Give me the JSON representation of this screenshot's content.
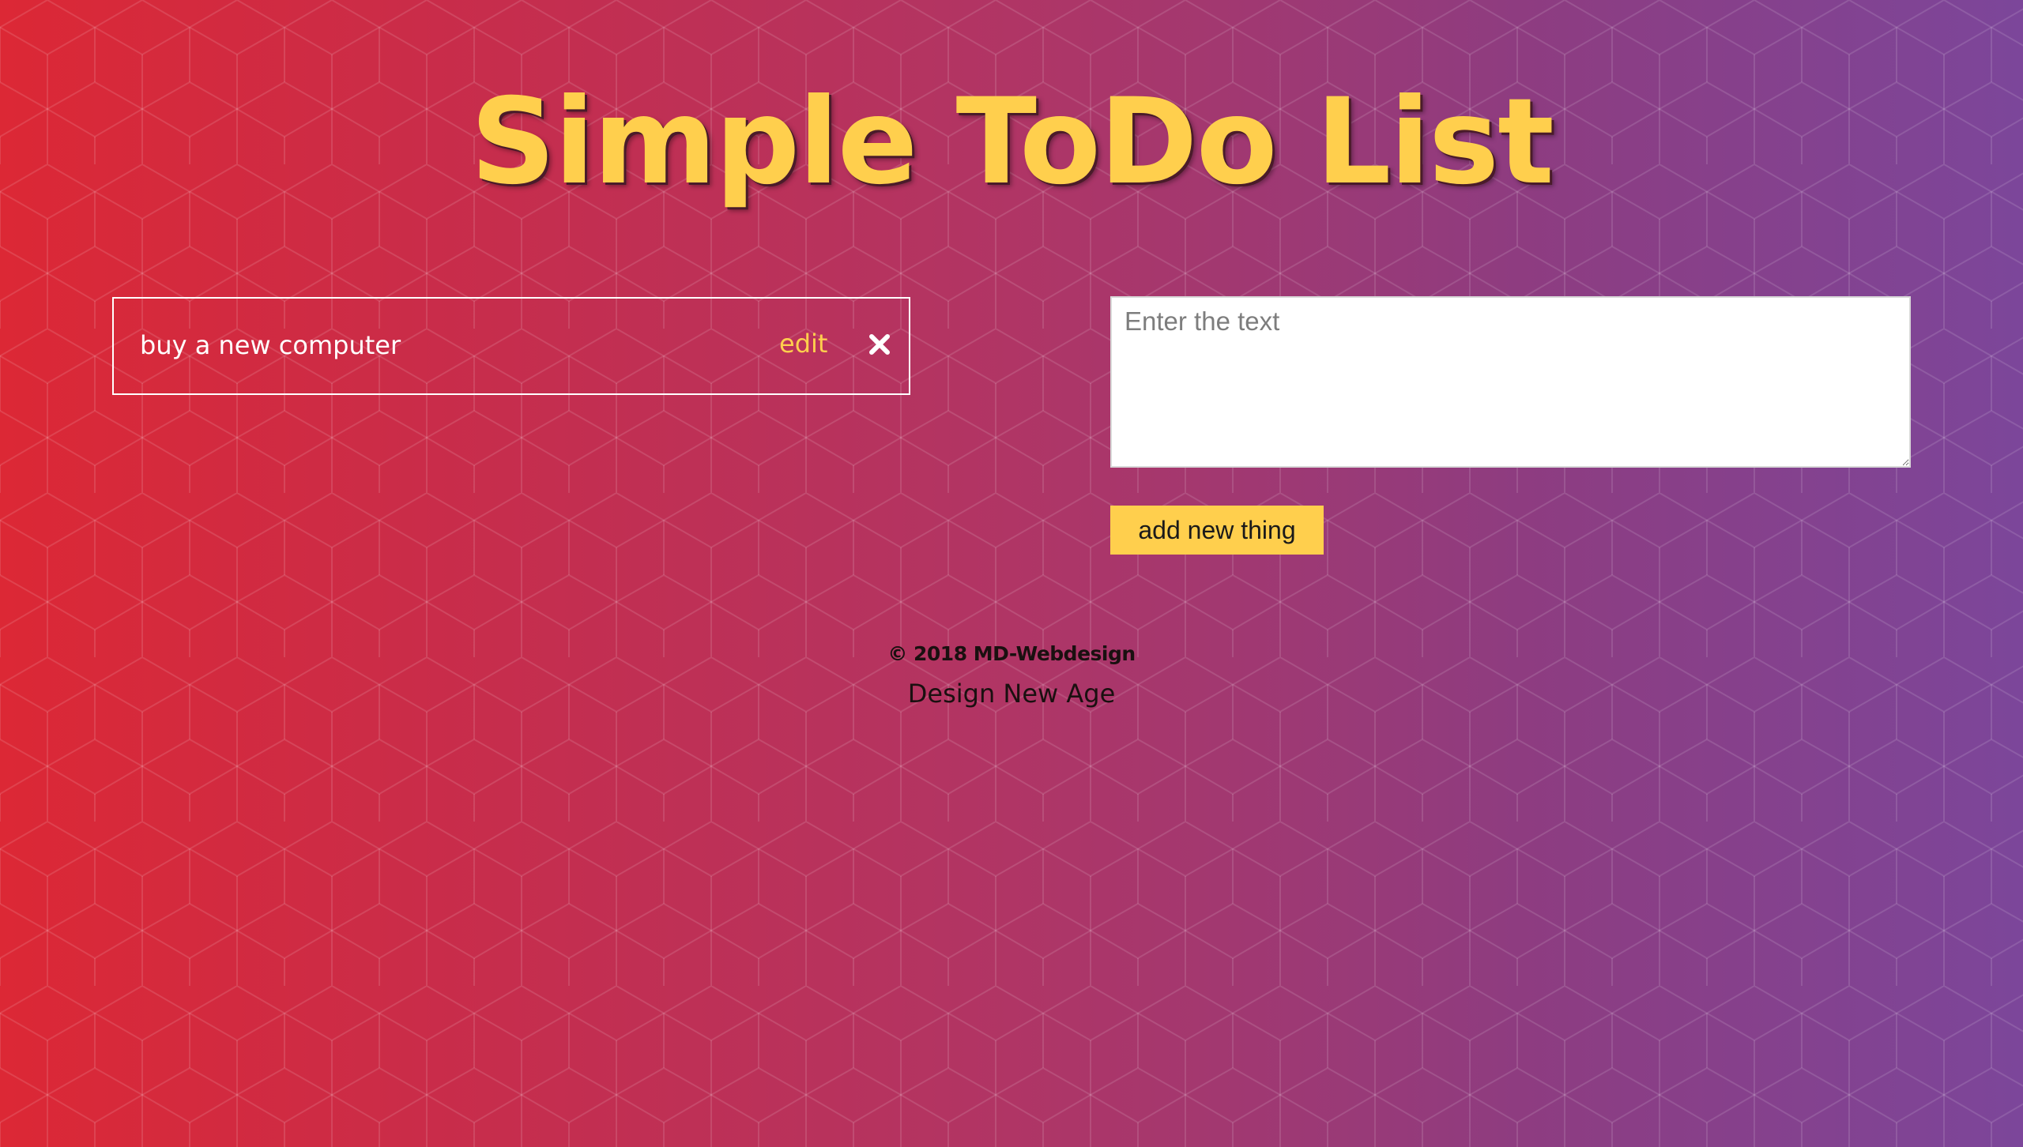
{
  "header": {
    "title": "Simple ToDo List"
  },
  "todos": [
    {
      "text": "buy a new computer",
      "edit_label": "edit",
      "delete_icon": "close-icon"
    }
  ],
  "form": {
    "placeholder": "Enter the text",
    "value": "",
    "add_label": "add new thing"
  },
  "footer": {
    "copyright": "© 2018 MD-Webdesign",
    "tagline": "Design New Age"
  },
  "colors": {
    "accent": "#ffcf4d",
    "gradient_start": "#dc2835",
    "gradient_end": "#7c469a",
    "todo_border": "#ffffff"
  }
}
